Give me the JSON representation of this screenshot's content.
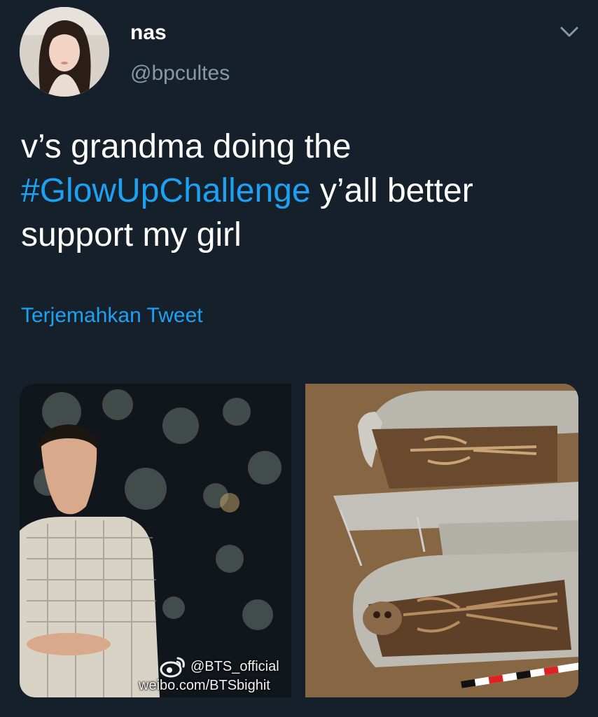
{
  "user": {
    "name": "nas",
    "handle": "@bpcultes"
  },
  "tweet": {
    "text_line1": "v’s grandma doing the",
    "hashtag": "#GlowUpChallenge",
    "text_after_hashtag": " y’all better",
    "text_line3": "support my girl",
    "translate_label": "Terjemahkan Tweet"
  },
  "media": {
    "watermark_handle": "@BTS_official",
    "watermark_url": "weibo.com/BTSbighit"
  },
  "icons": {
    "menu": "chevron-down-icon",
    "watermark": "weibo-icon"
  },
  "colors": {
    "background": "#15202b",
    "link": "#1da1f2",
    "secondary_text": "#8899a6"
  }
}
